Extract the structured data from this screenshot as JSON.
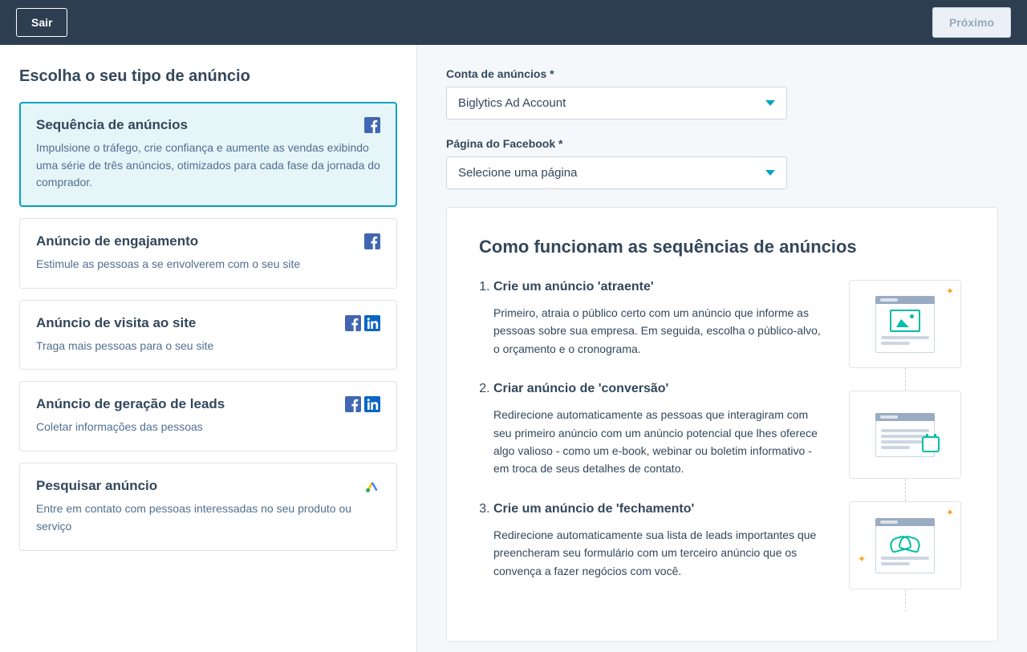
{
  "header": {
    "exit": "Sair",
    "next": "Próximo"
  },
  "left": {
    "heading": "Escolha o seu tipo de anúncio",
    "cards": [
      {
        "title": "Sequência de anúncios",
        "desc": "Impulsione o tráfego, crie confiança e aumente as vendas exibindo uma série de três anúncios, otimizados para cada fase da jornada do comprador.",
        "networks": [
          "facebook"
        ],
        "selected": true
      },
      {
        "title": "Anúncio de engajamento",
        "desc": "Estimule as pessoas a se envolverem com o seu site",
        "networks": [
          "facebook"
        ]
      },
      {
        "title": "Anúncio de visita ao site",
        "desc": "Traga mais pessoas para o seu site",
        "networks": [
          "facebook",
          "linkedin"
        ]
      },
      {
        "title": "Anúncio de geração de leads",
        "desc": "Coletar informações das pessoas",
        "networks": [
          "facebook",
          "linkedin"
        ]
      },
      {
        "title": "Pesquisar anúncio",
        "desc": "Entre em contato com pessoas interessadas no seu produto ou serviço",
        "networks": [
          "google-ads"
        ]
      }
    ]
  },
  "right": {
    "account_label": "Conta de anúncios *",
    "account_value": "Biglytics Ad Account",
    "page_label": "Página do Facebook *",
    "page_placeholder": "Selecione uma página",
    "panel_title": "Como funcionam as sequências de anúncios",
    "steps": [
      {
        "title": "Crie um anúncio 'atraente'",
        "desc": "Primeiro, atraia o público certo com um anúncio que informe as pessoas sobre sua empresa. Em seguida, escolha o público-alvo, o orçamento e o cronograma."
      },
      {
        "title": "Criar anúncio de 'conversão'",
        "desc": "Redirecione automaticamente as pessoas que interagiram com seu primeiro anúncio com um anúncio potencial que lhes oferece algo valioso - como um e-book, webinar ou boletim informativo - em troca de seus detalhes de contato."
      },
      {
        "title": "Crie um anúncio de 'fechamento'",
        "desc": "Redirecione automaticamente sua lista de leads importantes que preencheram seu formulário com um terceiro anúncio que os convença a fazer negócios com você."
      }
    ]
  }
}
